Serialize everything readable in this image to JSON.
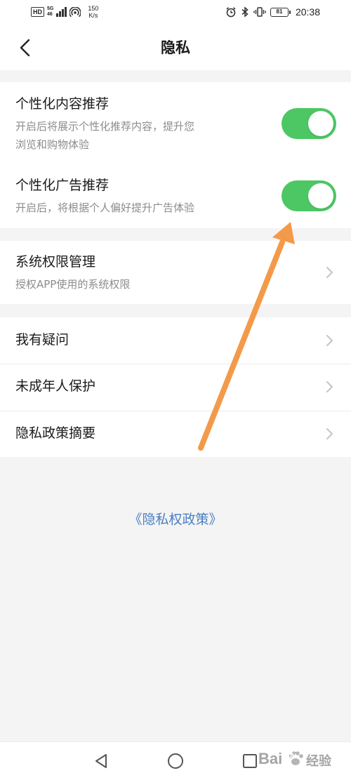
{
  "status_bar": {
    "hd_label": "HD",
    "network_label": "5G",
    "network_sub": "46",
    "speed_value": "150",
    "speed_unit": "K/s",
    "battery_level": "81",
    "time": "20:38"
  },
  "header": {
    "title": "隐私"
  },
  "settings": {
    "personalized_content": {
      "title": "个性化内容推荐",
      "desc_line1": "开启后将展示个性化推荐内容，提升您",
      "desc_line2": "浏览和购物体验",
      "enabled": true
    },
    "personalized_ads": {
      "title": "个性化广告推荐",
      "desc": "开启后，将根据个人偏好提升广告体验",
      "enabled": true
    },
    "system_permissions": {
      "title": "系统权限管理",
      "desc": "授权APP使用的系统权限"
    },
    "links": [
      {
        "label": "我有疑问"
      },
      {
        "label": "未成年人保护"
      },
      {
        "label": "隐私政策摘要"
      }
    ]
  },
  "policy_link": "《隐私权政策》",
  "watermark": {
    "brand": "Bai",
    "brand_suffix": "du",
    "product": "经验"
  },
  "colors": {
    "toggle_on": "#4cc764",
    "link": "#4a7fc1",
    "annotation_arrow": "#f39a4a"
  }
}
